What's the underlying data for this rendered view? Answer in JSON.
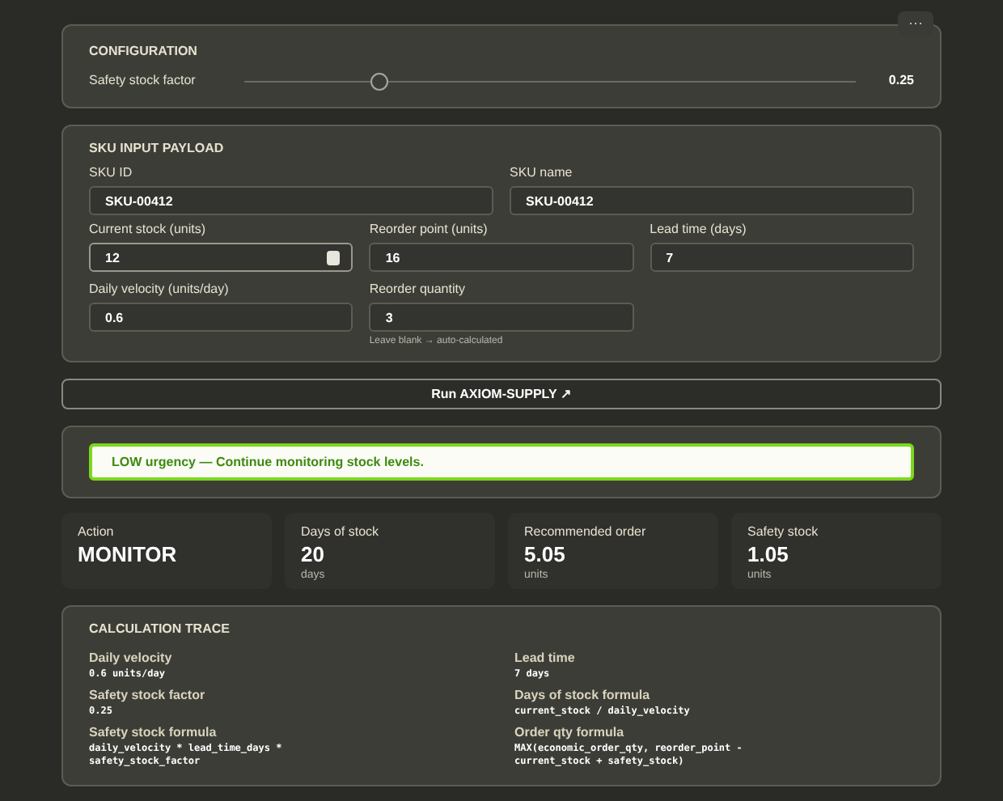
{
  "menu_button": {
    "label": "···"
  },
  "configuration": {
    "title": "CONFIGURATION",
    "slider": {
      "label": "Safety stock factor",
      "level": 0.22,
      "reading": "0.25"
    }
  },
  "sku_input": {
    "title": "SKU INPUT PAYLOAD",
    "identity_fields": [
      {
        "label": "SKU ID",
        "value": "SKU-00412"
      },
      {
        "label": "SKU name",
        "value": "SKU-00412"
      }
    ],
    "quantity_fields": [
      {
        "label": "Current stock (units)",
        "value": "12",
        "focused": true
      },
      {
        "label": "Reorder point (units)",
        "value": "16",
        "focused": false
      },
      {
        "label": "Lead time (days)",
        "value": "7",
        "focused": false
      },
      {
        "label": "Daily velocity (units/day)",
        "value": "0.6",
        "focused": false
      },
      {
        "label": "Reorder quantity",
        "value": "3",
        "focused": false,
        "hint": "Leave blank → auto-calculated"
      }
    ]
  },
  "run_button": {
    "label": "Run AXIOM-SUPPLY ↗"
  },
  "alert": {
    "text": "LOW urgency — Continue monitoring stock levels."
  },
  "stats": [
    {
      "label": "Action",
      "value": "MONITOR"
    },
    {
      "label": "Days of stock",
      "value": "20",
      "unit": "days"
    },
    {
      "label": "Recommended order",
      "value": "5.05",
      "unit": "units"
    },
    {
      "label": "Safety stock",
      "value": "1.05",
      "unit": "units"
    }
  ],
  "trace": {
    "title": "CALCULATION TRACE",
    "items": [
      {
        "label": "Daily velocity",
        "value": "0.6 units/day"
      },
      {
        "label": "Lead time",
        "value": "7 days"
      },
      {
        "label": "Safety stock factor",
        "value": "0.25"
      },
      {
        "label": "Days of stock formula",
        "value": "current_stock / daily_velocity"
      },
      {
        "label": "Safety stock formula",
        "value": "daily_velocity * lead_time_days * safety_stock_factor"
      },
      {
        "label": "Order qty formula",
        "value": "MAX(economic_order_qty, reorder_point - current_stock + safety_stock)"
      }
    ]
  }
}
